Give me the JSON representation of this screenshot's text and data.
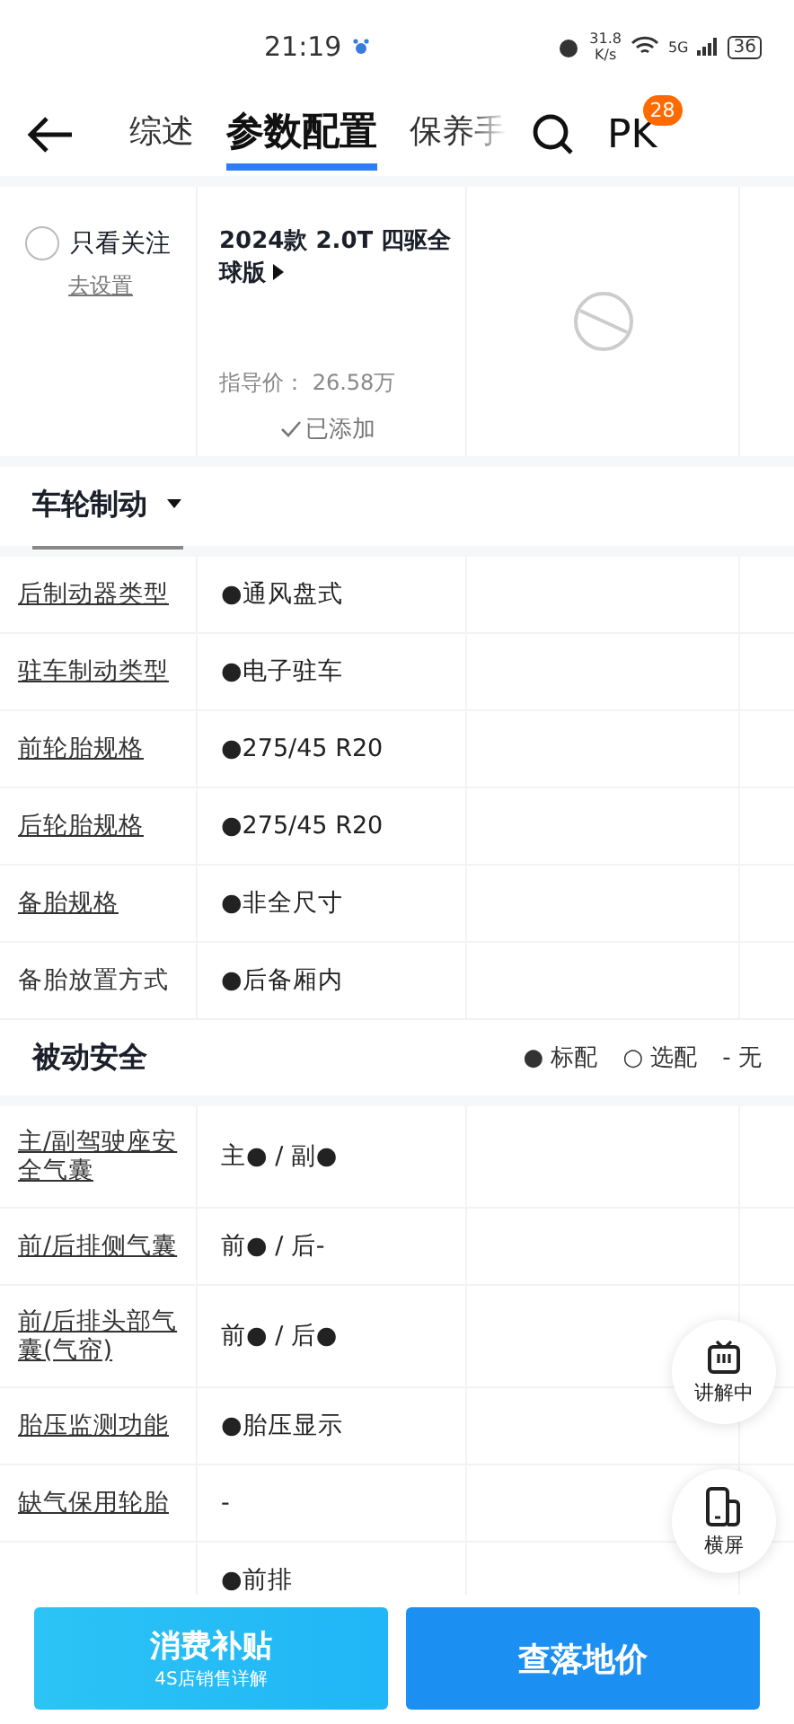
{
  "status_bar": {
    "time": "21:19",
    "speed_value": "31.8",
    "speed_unit": "K/s",
    "network": "5G",
    "battery": "36"
  },
  "nav": {
    "tabs": [
      {
        "label": "综述",
        "selected": false
      },
      {
        "label": "参数配置",
        "selected": true
      },
      {
        "label": "保养手",
        "selected": false
      }
    ],
    "pk": {
      "label": "PK",
      "badge": "28"
    }
  },
  "header": {
    "only_followed": {
      "label": "只看关注",
      "checked": false,
      "link": "去设置"
    },
    "car": {
      "name": "2024款 2.0T 四驱全球版",
      "price_label": "指导价：",
      "price": "26.58万",
      "added": "已添加"
    }
  },
  "sections": [
    {
      "title": "车轮制动",
      "dropdown": true,
      "rows": [
        {
          "label": "后制动器类型",
          "underlined": true,
          "value": "●通风盘式"
        },
        {
          "label": "驻车制动类型",
          "underlined": true,
          "value": "●电子驻车"
        },
        {
          "label": "前轮胎规格",
          "underlined": true,
          "value": "●275/45 R20"
        },
        {
          "label": "后轮胎规格",
          "underlined": true,
          "value": "●275/45 R20"
        },
        {
          "label": "备胎规格",
          "underlined": true,
          "value": "●非全尺寸"
        },
        {
          "label": "备胎放置方式",
          "underlined": false,
          "value": "●后备厢内"
        }
      ]
    },
    {
      "title": "被动安全",
      "dropdown": false,
      "legend": [
        "● 标配",
        "○ 选配",
        "- 无"
      ],
      "rows": [
        {
          "label": "主/副驾驶座安全气囊",
          "underlined": true,
          "value": "主● / 副●"
        },
        {
          "label": "前/后排侧气囊",
          "underlined": true,
          "value": "前● / 后-"
        },
        {
          "label": "前/后排头部气囊(气帘)",
          "underlined": true,
          "value": "前● / 后●"
        },
        {
          "label": "胎压监测功能",
          "underlined": true,
          "value": "●胎压显示"
        },
        {
          "label": "缺气保用轮胎",
          "underlined": true,
          "value": "-"
        },
        {
          "value": "●前排"
        }
      ]
    }
  ],
  "floating": [
    {
      "kind": "tv",
      "label": "讲解中"
    },
    {
      "kind": "rotate",
      "label": "横屏"
    }
  ],
  "bottom": {
    "subsidy": {
      "title": "消费补贴",
      "subtitle": "4S店销售详解"
    },
    "price_button": "查落地价"
  }
}
